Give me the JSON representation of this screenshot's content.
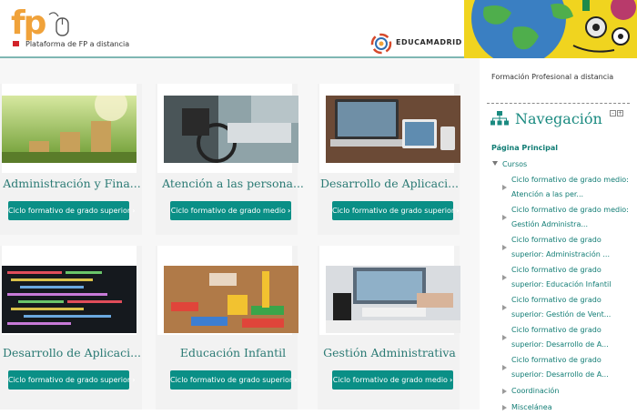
{
  "header": {
    "logo_text": "fp",
    "logo_subtitle": "Plataforma de FP a distancia",
    "partner_logo": "EducaMadrid",
    "partner_text": "EDUCAMADRID"
  },
  "courses": [
    {
      "title": "Administración y Fina...",
      "button": "Ciclo formativo de grado superior",
      "image": "coins-growth-photo"
    },
    {
      "title": "Atención a las persona...",
      "button": "Ciclo formativo de grado medio",
      "image": "wheelchair-photo"
    },
    {
      "title": "Desarrollo de Aplicaci...",
      "button": "Ciclo formativo de grado superior",
      "image": "devices-photo"
    },
    {
      "title": "Desarrollo de Aplicaci...",
      "button": "Ciclo formativo de grado superior",
      "image": "code-screen-photo"
    },
    {
      "title": "Educación Infantil",
      "button": "Ciclo formativo de grado superior",
      "image": "blocks-photo"
    },
    {
      "title": "Gestión Administrativa",
      "button": "Ciclo formativo de grado medio",
      "image": "office-desk-photo"
    }
  ],
  "sidebar": {
    "site_name": "Formación Profesional a distancia",
    "nav_title": "Navegación",
    "home": "Página Principal",
    "cursos": "Cursos",
    "items": [
      {
        "line1": "Ciclo formativo de grado medio:",
        "line2": "Atención a las per..."
      },
      {
        "line1": "Ciclo formativo de grado medio:",
        "line2": "Gestión Administra..."
      },
      {
        "line1": "Ciclo formativo de grado",
        "line2": "superior: Administración ..."
      },
      {
        "line1": "Ciclo formativo de grado",
        "line2": "superior: Educación Infantil"
      },
      {
        "line1": "Ciclo formativo de grado",
        "line2": "superior: Gestión de Vent..."
      },
      {
        "line1": "Ciclo formativo de grado",
        "line2": "superior: Desarrollo de A..."
      },
      {
        "line1": "Ciclo formativo de grado",
        "line2": "superior: Desarrollo de A..."
      },
      {
        "line1": "Coordinación",
        "line2": ""
      },
      {
        "line1": "Miscelánea",
        "line2": ""
      }
    ]
  },
  "colors": {
    "accent": "#0a8f86",
    "title": "#2b7a74",
    "logo": "#f0a23a"
  }
}
